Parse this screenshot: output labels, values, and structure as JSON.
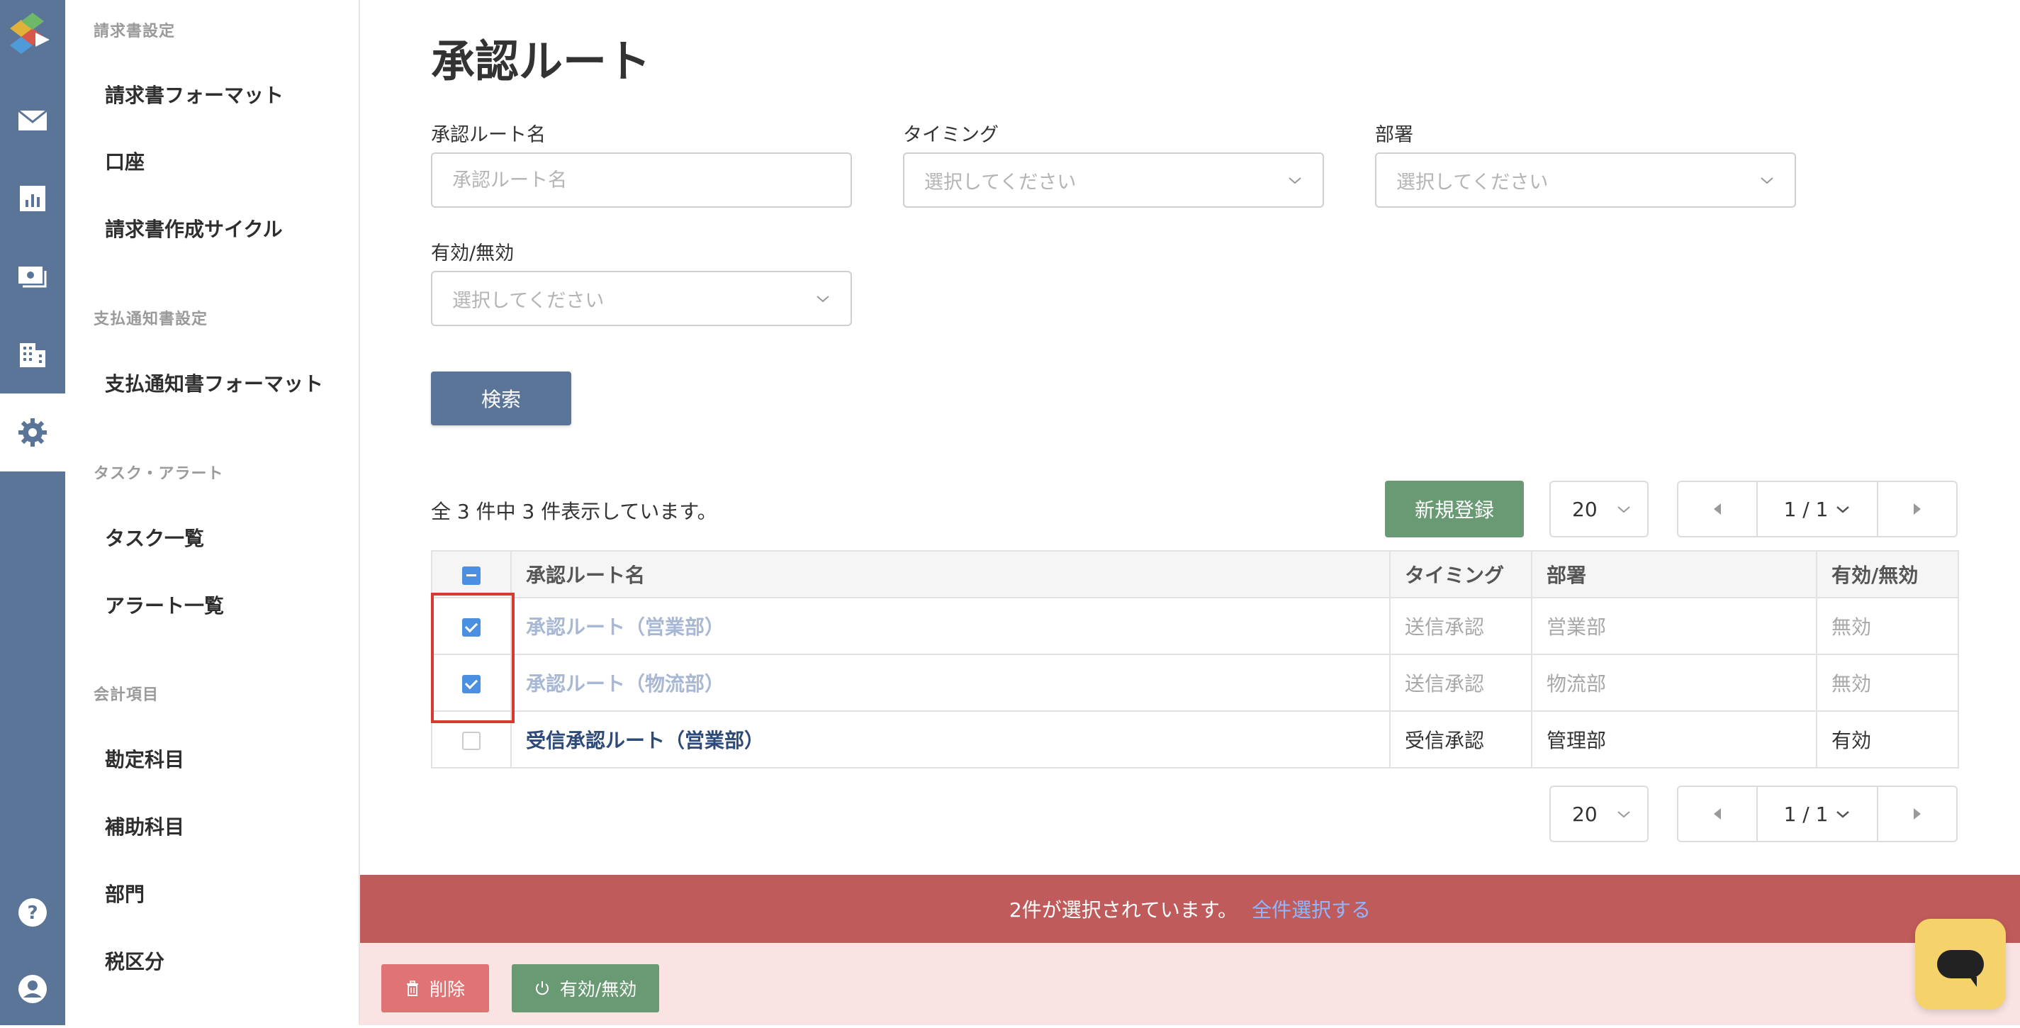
{
  "sidebar": {
    "sections": [
      {
        "title": "請求書設定",
        "items": [
          "請求書フォーマット",
          "口座",
          "請求書作成サイクル"
        ]
      },
      {
        "title": "支払通知書設定",
        "items": [
          "支払通知書フォーマット"
        ]
      },
      {
        "title": "タスク・アラート",
        "items": [
          "タスク一覧",
          "アラート一覧"
        ]
      },
      {
        "title": "会計項目",
        "items": [
          "勘定科目",
          "補助科目",
          "部門",
          "税区分"
        ]
      }
    ]
  },
  "page": {
    "title": "承認ルート"
  },
  "filters": {
    "route_name": {
      "label": "承認ルート名",
      "placeholder": "承認ルート名",
      "value": ""
    },
    "timing": {
      "label": "タイミング",
      "placeholder": "選択してください"
    },
    "department": {
      "label": "部署",
      "placeholder": "選択してください"
    },
    "status": {
      "label": "有効/無効",
      "placeholder": "選択してください"
    },
    "search_label": "検索"
  },
  "list": {
    "count_text": "全 3 件中 3 件表示しています。",
    "new_label": "新規登録",
    "per_page": "20",
    "page_indicator": "1 / 1",
    "columns": [
      "承認ルート名",
      "タイミング",
      "部署",
      "有効/無効"
    ],
    "rows": [
      {
        "name": "承認ルート（営業部）",
        "timing": "送信承認",
        "department": "営業部",
        "status": "無効",
        "checked": true
      },
      {
        "name": "承認ルート（物流部）",
        "timing": "送信承認",
        "department": "物流部",
        "status": "無効",
        "checked": true
      },
      {
        "name": "受信承認ルート（営業部）",
        "timing": "受信承認",
        "department": "管理部",
        "status": "有効",
        "checked": false
      }
    ]
  },
  "selection": {
    "message": "2件が選択されています。",
    "select_all": "全件選択する",
    "delete_label": "削除",
    "toggle_label": "有効/無効"
  },
  "colors": {
    "rail": "#5b7599",
    "primary": "#5b7599",
    "success": "#6a9a74",
    "danger_bar": "#c05b5b",
    "danger_button": "#e07474",
    "checkbox": "#4a8fe0",
    "chat": "#f5d36a"
  },
  "icons": {
    "rail": [
      "logo-icon",
      "mail-icon",
      "chart-icon",
      "invoice-icon",
      "building-icon",
      "gear-icon",
      "help-icon",
      "account-icon"
    ]
  }
}
